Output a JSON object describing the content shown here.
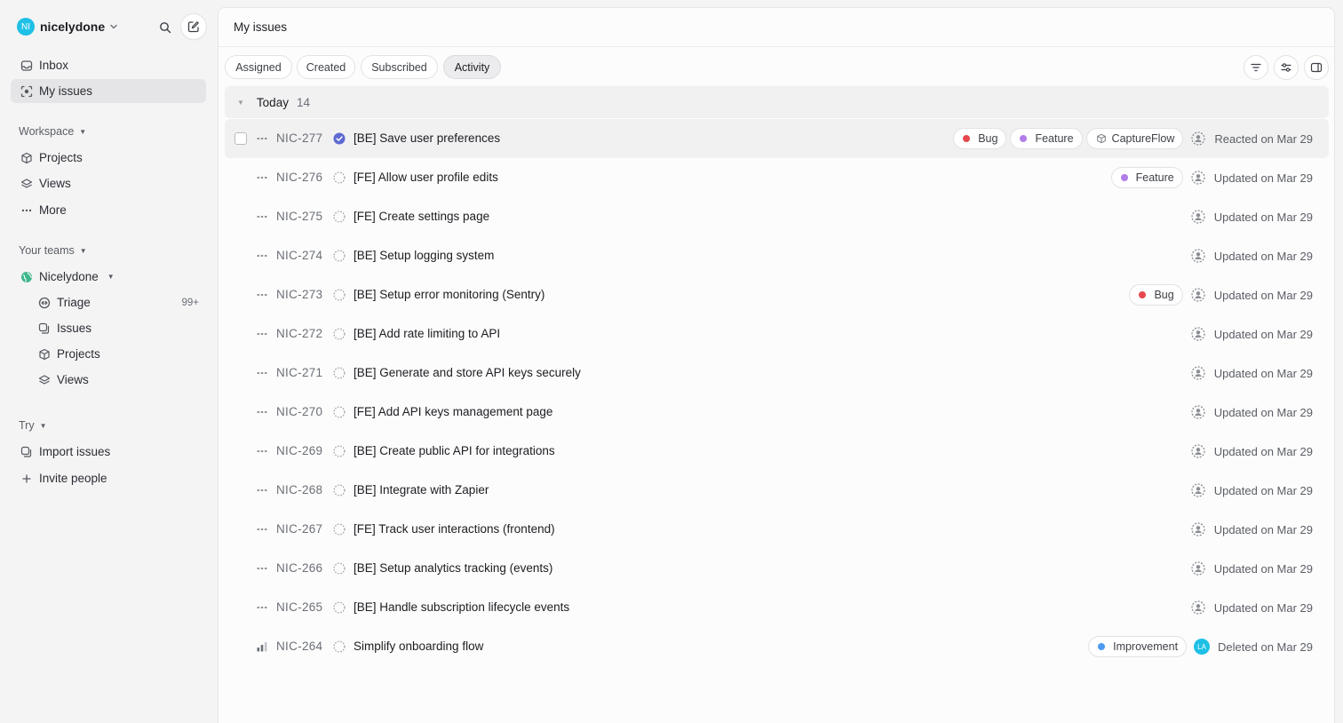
{
  "workspace": {
    "initials": "NI",
    "name": "nicelydone"
  },
  "sidebar": {
    "top_items": [
      {
        "label": "Inbox",
        "icon": "inbox-icon"
      },
      {
        "label": "My issues",
        "icon": "my-issues-icon",
        "active": true
      }
    ],
    "workspace_section": {
      "label": "Workspace",
      "items": [
        {
          "label": "Projects",
          "icon": "cube-icon"
        },
        {
          "label": "Views",
          "icon": "layers-icon"
        },
        {
          "label": "More",
          "icon": "dots-icon"
        }
      ]
    },
    "teams_section": {
      "label": "Your teams",
      "team": {
        "label": "Nicelydone",
        "icon": "team-globe-icon"
      },
      "items": [
        {
          "label": "Triage",
          "icon": "triage-icon",
          "count": "99+"
        },
        {
          "label": "Issues",
          "icon": "issues-icon"
        },
        {
          "label": "Projects",
          "icon": "cube-icon"
        },
        {
          "label": "Views",
          "icon": "layers-icon"
        }
      ]
    },
    "try_section": {
      "label": "Try",
      "items": [
        {
          "label": "Import issues",
          "icon": "import-icon"
        },
        {
          "label": "Invite people",
          "icon": "plus-icon"
        }
      ]
    }
  },
  "main": {
    "title": "My issues",
    "tabs": [
      {
        "label": "Assigned"
      },
      {
        "label": "Created"
      },
      {
        "label": "Subscribed"
      },
      {
        "label": "Activity",
        "active": true
      }
    ],
    "group": {
      "label": "Today",
      "count": "14"
    },
    "issues": [
      {
        "id": "NIC-277",
        "title": "[BE] Save user preferences",
        "status": "done",
        "priority": "none",
        "labels": [
          {
            "name": "Bug",
            "color": "#e5484d"
          },
          {
            "name": "Feature",
            "color": "#b07ee8"
          }
        ],
        "project": "CaptureFlow",
        "activity": "Reacted on Mar 29",
        "avatar": "unassigned"
      },
      {
        "id": "NIC-276",
        "title": "[FE] Allow user profile edits",
        "status": "backlog",
        "priority": "none",
        "labels": [
          {
            "name": "Feature",
            "color": "#b07ee8"
          }
        ],
        "activity": "Updated on Mar 29",
        "avatar": "unassigned"
      },
      {
        "id": "NIC-275",
        "title": "[FE] Create settings page",
        "status": "backlog",
        "priority": "none",
        "labels": [],
        "activity": "Updated on Mar 29",
        "avatar": "unassigned"
      },
      {
        "id": "NIC-274",
        "title": "[BE] Setup logging system",
        "status": "backlog",
        "priority": "none",
        "labels": [],
        "activity": "Updated on Mar 29",
        "avatar": "unassigned"
      },
      {
        "id": "NIC-273",
        "title": "[BE] Setup error monitoring (Sentry)",
        "status": "backlog",
        "priority": "none",
        "labels": [
          {
            "name": "Bug",
            "color": "#e5484d"
          }
        ],
        "activity": "Updated on Mar 29",
        "avatar": "unassigned"
      },
      {
        "id": "NIC-272",
        "title": "[BE] Add rate limiting to API",
        "status": "backlog",
        "priority": "none",
        "labels": [],
        "activity": "Updated on Mar 29",
        "avatar": "unassigned"
      },
      {
        "id": "NIC-271",
        "title": "[BE] Generate and store API keys securely",
        "status": "backlog",
        "priority": "none",
        "labels": [],
        "activity": "Updated on Mar 29",
        "avatar": "unassigned"
      },
      {
        "id": "NIC-270",
        "title": "[FE] Add API keys management page",
        "status": "backlog",
        "priority": "none",
        "labels": [],
        "activity": "Updated on Mar 29",
        "avatar": "unassigned"
      },
      {
        "id": "NIC-269",
        "title": "[BE] Create public API for integrations",
        "status": "backlog",
        "priority": "none",
        "labels": [],
        "activity": "Updated on Mar 29",
        "avatar": "unassigned"
      },
      {
        "id": "NIC-268",
        "title": "[BE] Integrate with Zapier",
        "status": "backlog",
        "priority": "none",
        "labels": [],
        "activity": "Updated on Mar 29",
        "avatar": "unassigned"
      },
      {
        "id": "NIC-267",
        "title": "[FE] Track user interactions (frontend)",
        "status": "backlog",
        "priority": "none",
        "labels": [],
        "activity": "Updated on Mar 29",
        "avatar": "unassigned"
      },
      {
        "id": "NIC-266",
        "title": "[BE] Setup analytics tracking (events)",
        "status": "backlog",
        "priority": "none",
        "labels": [],
        "activity": "Updated on Mar 29",
        "avatar": "unassigned"
      },
      {
        "id": "NIC-265",
        "title": "[BE] Handle subscription lifecycle events",
        "status": "backlog",
        "priority": "none",
        "labels": [],
        "activity": "Updated on Mar 29",
        "avatar": "unassigned"
      },
      {
        "id": "NIC-264",
        "title": "Simplify onboarding flow",
        "status": "backlog",
        "priority": "medium",
        "labels": [
          {
            "name": "Improvement",
            "color": "#4c9bf0"
          }
        ],
        "activity": "Deleted on Mar 29",
        "avatar": "LA"
      }
    ]
  }
}
